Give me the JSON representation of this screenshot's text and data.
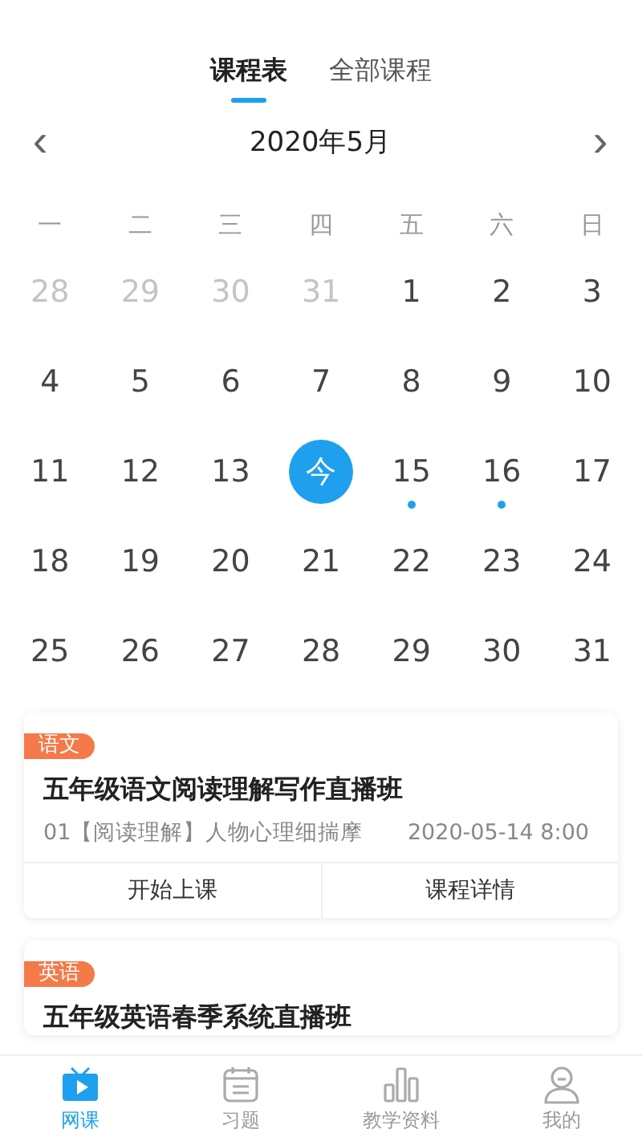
{
  "tabs": [
    {
      "label": "课程表",
      "selected": true
    },
    {
      "label": "全部课程",
      "selected": false
    }
  ],
  "calendar": {
    "month": "2020年5月",
    "prev": "‹",
    "next": "›",
    "weekdays": [
      "一",
      "二",
      "三",
      "四",
      "五",
      "六",
      "日"
    ],
    "days": [
      {
        "label": "28",
        "kind": "other"
      },
      {
        "label": "29",
        "kind": "other"
      },
      {
        "label": "30",
        "kind": "other"
      },
      {
        "label": "31",
        "kind": "other"
      },
      {
        "label": "1",
        "kind": "normal"
      },
      {
        "label": "2",
        "kind": "normal"
      },
      {
        "label": "3",
        "kind": "normal"
      },
      {
        "label": "4",
        "kind": "normal"
      },
      {
        "label": "5",
        "kind": "normal"
      },
      {
        "label": "6",
        "kind": "normal"
      },
      {
        "label": "7",
        "kind": "normal"
      },
      {
        "label": "8",
        "kind": "normal"
      },
      {
        "label": "9",
        "kind": "normal"
      },
      {
        "label": "10",
        "kind": "normal"
      },
      {
        "label": "11",
        "kind": "normal"
      },
      {
        "label": "12",
        "kind": "normal"
      },
      {
        "label": "13",
        "kind": "normal"
      },
      {
        "label": "今",
        "kind": "today",
        "selected": true
      },
      {
        "label": "15",
        "kind": "normal",
        "has_class": true
      },
      {
        "label": "16",
        "kind": "normal",
        "has_class": true
      },
      {
        "label": "17",
        "kind": "normal"
      },
      {
        "label": "18",
        "kind": "normal"
      },
      {
        "label": "19",
        "kind": "normal"
      },
      {
        "label": "20",
        "kind": "normal"
      },
      {
        "label": "21",
        "kind": "normal"
      },
      {
        "label": "22",
        "kind": "normal"
      },
      {
        "label": "23",
        "kind": "normal"
      },
      {
        "label": "24",
        "kind": "normal"
      },
      {
        "label": "25",
        "kind": "normal"
      },
      {
        "label": "26",
        "kind": "normal"
      },
      {
        "label": "27",
        "kind": "normal"
      },
      {
        "label": "28",
        "kind": "normal"
      },
      {
        "label": "29",
        "kind": "normal"
      },
      {
        "label": "30",
        "kind": "normal"
      },
      {
        "label": "31",
        "kind": "normal"
      }
    ]
  },
  "courses": [
    {
      "tag": "语文",
      "title": "五年级语文阅读理解写作直播班",
      "lesson": "01【阅读理解】人物心理细揣摩",
      "time": "2020-05-14 8:00",
      "buttons": [
        "开始上课",
        "课程详情"
      ]
    },
    {
      "tag": "英语",
      "title": "五年级英语春季系统直播班"
    }
  ],
  "nav": [
    {
      "label": "网课",
      "kind": "tv",
      "selected": true
    },
    {
      "label": "习题",
      "kind": "calendar",
      "selected": false
    },
    {
      "label": "教学资料",
      "kind": "chart",
      "selected": false
    },
    {
      "label": "我的",
      "kind": "profile",
      "selected": false
    }
  ]
}
